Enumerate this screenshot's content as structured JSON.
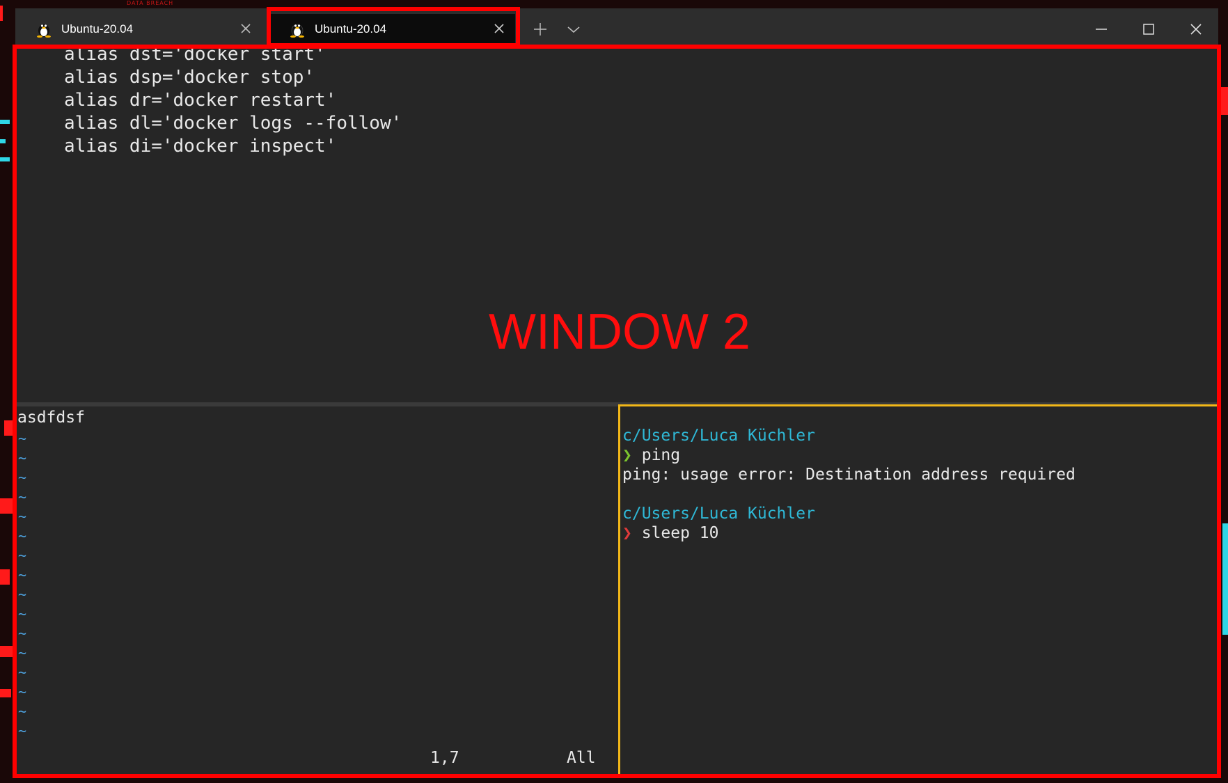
{
  "tabs": [
    {
      "label": "Ubuntu-20.04",
      "active": false
    },
    {
      "label": "Ubuntu-20.04",
      "active": true
    }
  ],
  "background": {
    "watermark": "DATA BREACH"
  },
  "top_pane": {
    "lines": [
      "alias dst='docker start'",
      "alias dsp='docker stop'",
      "alias dr='docker restart'",
      "alias dl='docker logs --follow'",
      "alias di='docker inspect'"
    ]
  },
  "annotation": {
    "label": "WINDOW 2"
  },
  "vim_pane": {
    "first_line": "asdfdsf",
    "tilde": "~",
    "position": "1,7",
    "scroll": "All"
  },
  "shell_pane": {
    "path1": "c/Users/Luca Küchler",
    "prompt_symbol": "❯",
    "cmd1": "ping",
    "output1": "ping: usage error: Destination address required",
    "path2": "c/Users/Luca Küchler",
    "cmd2": "sleep 10"
  },
  "colors": {
    "annotation": "#ff0000",
    "active_pane_border": "#f2b718",
    "path": "#2fb8d6",
    "prompt_ok": "#7cc52e",
    "prompt_err": "#e23a3a",
    "vim_tilde": "#4ea3e0"
  },
  "icons": {
    "tab": "tux-icon",
    "tab_close": "close-icon",
    "new_tab": "plus-icon",
    "dropdown": "chevron-down-icon",
    "minimize": "minimize-icon",
    "maximize": "maximize-icon",
    "close_window": "close-icon"
  }
}
